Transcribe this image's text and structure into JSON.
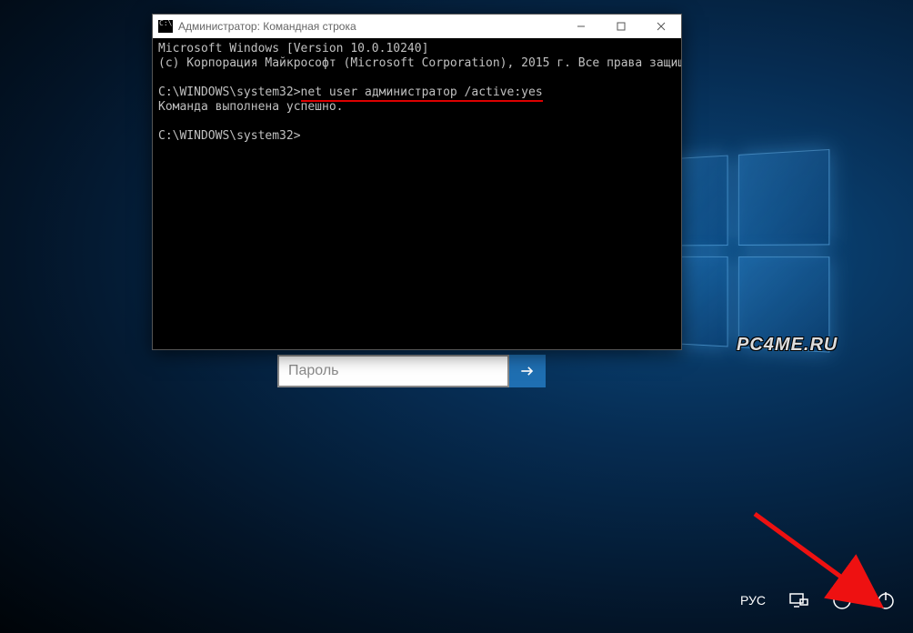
{
  "login": {
    "password_placeholder": "Пароль"
  },
  "cmd": {
    "title": "Администратор: Командная строка",
    "line_version": "Microsoft Windows [Version 10.0.10240]",
    "line_copyright": "(c) Корпорация Майкрософт (Microsoft Corporation), 2015 г. Все права защищены.",
    "prompt1_prefix": "C:\\WINDOWS\\system32>",
    "prompt1_cmd": "net user администратор /active:yes",
    "line_result": "Команда выполнена успешно.",
    "prompt2": "C:\\WINDOWS\\system32>"
  },
  "tray": {
    "lang": "РУС"
  },
  "watermark": "PC4ME.RU"
}
